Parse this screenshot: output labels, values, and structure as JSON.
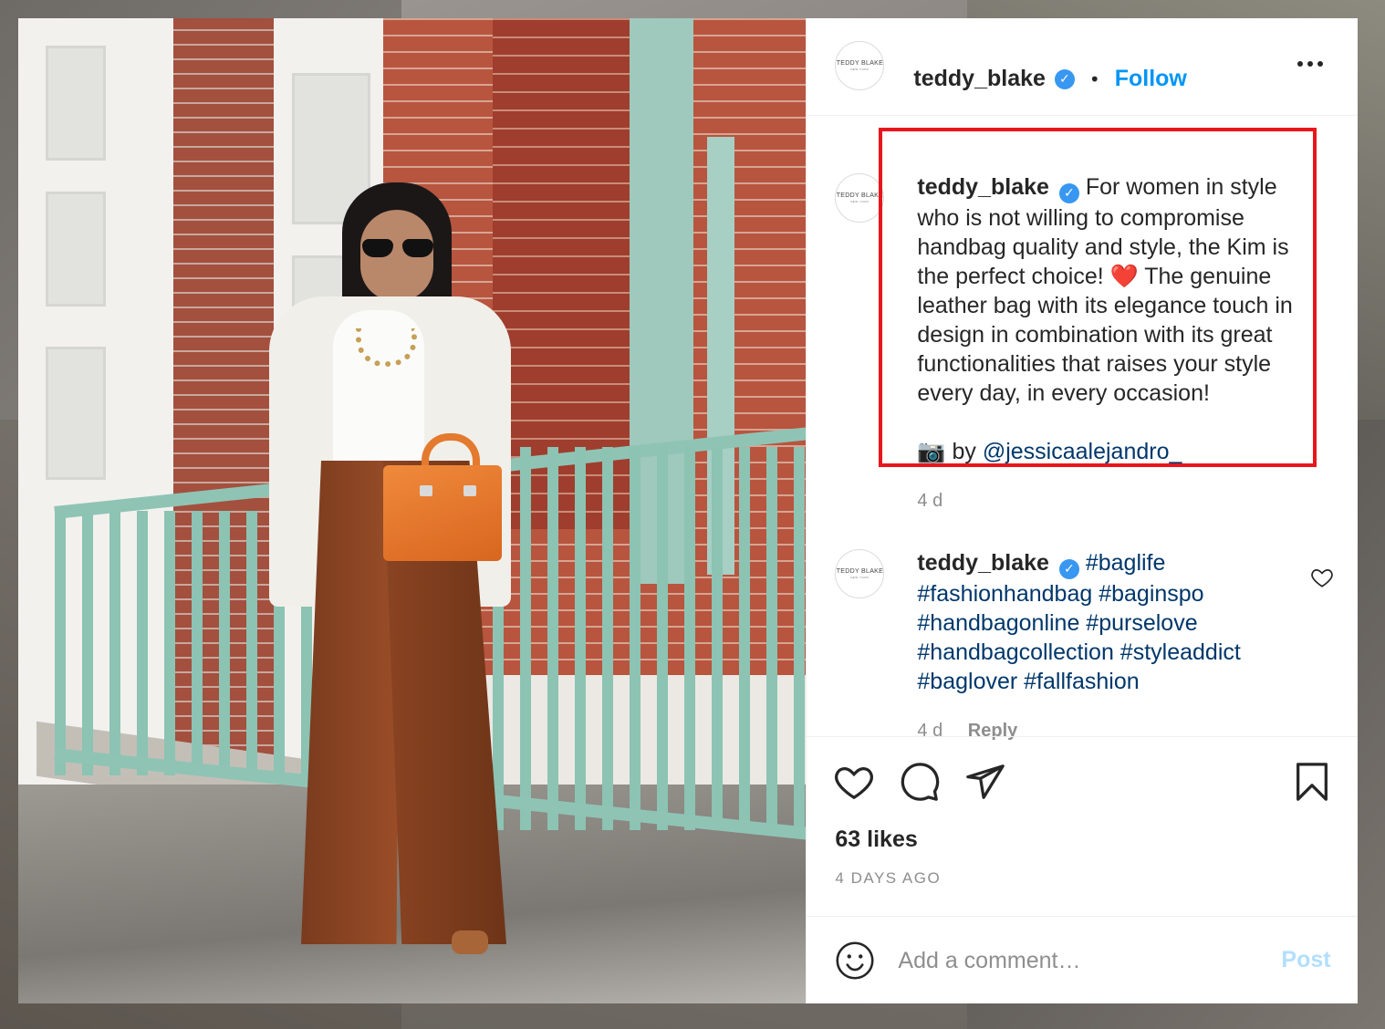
{
  "post": {
    "username": "teddy_blake",
    "verified_glyph": "✓",
    "follow_label": "Follow",
    "separator": "•",
    "more_icon": "more-horizontal-icon",
    "avatar_logo": "TEDDY BLAKE",
    "avatar_sub": "NEW YORK"
  },
  "caption": {
    "username": "teddy_blake",
    "lines": [
      "For women in style",
      "who is not willing to compromise",
      "handbag quality and style, the Kim is",
      "the perfect choice! ❤️ The genuine",
      "leather bag with its elegance touch in",
      "design in combination with its great",
      "functionalities that raises your style",
      "every day, in every occasion!"
    ],
    "credit_prefix": "📷 by ",
    "credit_handle": "@jessicaalejandro_",
    "time": "4 d"
  },
  "comment": {
    "username": "teddy_blake",
    "hashtag_lines": [
      "#baglife",
      "#fashionhandbag #baginspo",
      "#handbagonline #purselove",
      "#handbagcollection #styleaddict",
      "#baglover #fallfashion"
    ],
    "time": "4 d",
    "reply_label": "Reply"
  },
  "actions": {
    "like_icon": "heart-icon",
    "comment_icon": "comment-icon",
    "share_icon": "send-icon",
    "save_icon": "bookmark-icon",
    "likes": "63 likes",
    "posted_ago": "4 DAYS AGO"
  },
  "composer": {
    "placeholder": "Add a comment…",
    "post_label": "Post"
  },
  "colors": {
    "link": "#00376b",
    "follow": "#0095f6",
    "highlight_box": "#e8161b",
    "verified": "#3897f0"
  }
}
